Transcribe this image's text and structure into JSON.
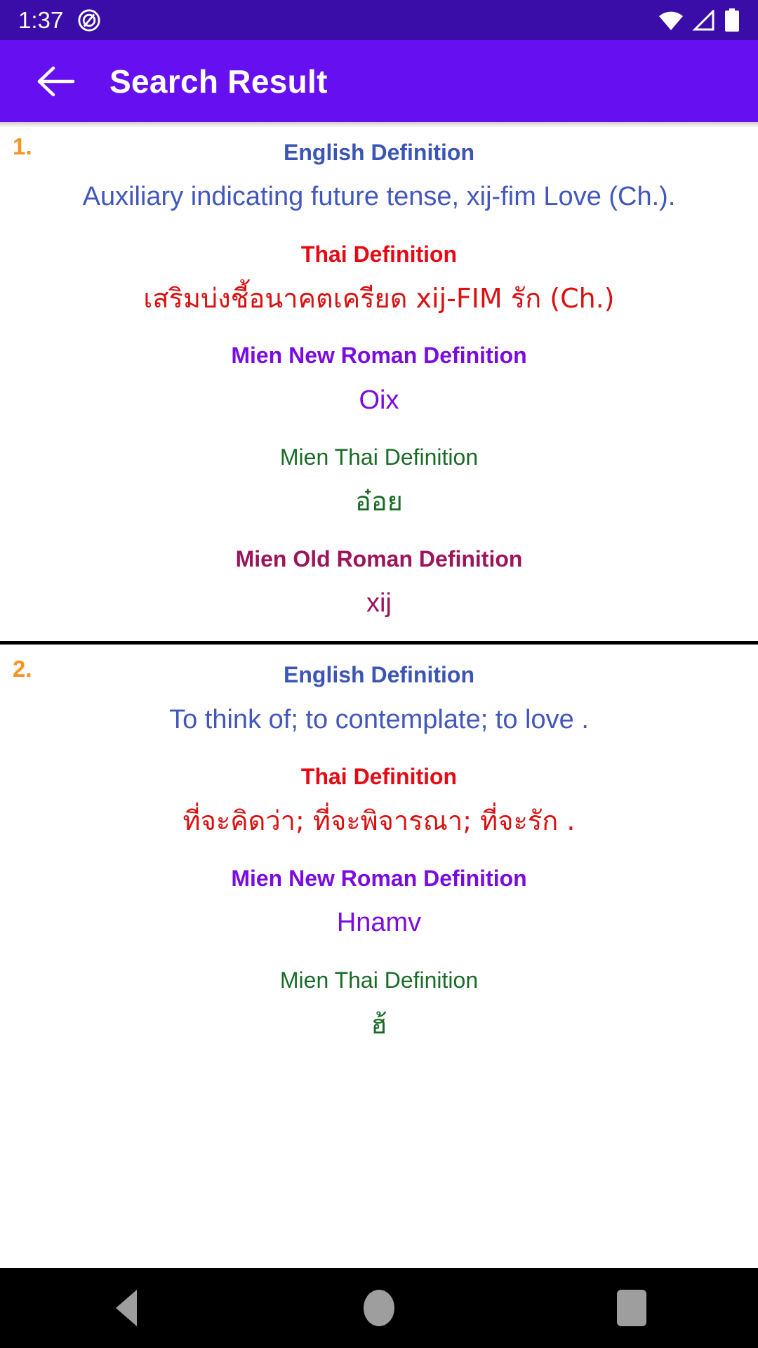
{
  "status_bar": {
    "time": "1:37",
    "app_icon": "app-notification-icon",
    "icons": [
      "wifi-icon",
      "cellular-signal-icon",
      "battery-icon"
    ],
    "background_color": "#3a0ca8"
  },
  "app_bar": {
    "back_icon": "arrow-left-icon",
    "title": "Search Result",
    "background_color": "#6610f2"
  },
  "colors": {
    "english_label": "#3b55b5",
    "english_value": "#4257bb",
    "thai_label": "#e50914",
    "thai_value": "#d81212",
    "mien_new_roman": "#7b0ce0",
    "mien_thai": "#1a6b28",
    "mien_old_roman": "#9c1459",
    "index_number": "#f79420",
    "divider": "#000000"
  },
  "results": [
    {
      "index": "1.",
      "fields": [
        {
          "label": "English Definition",
          "value": "Auxiliary indicating future tense, xij-fim Love (Ch.)."
        },
        {
          "label": "Thai Definition",
          "value": "เสริมบ่งชี้อนาคตเครียด xij-FIM รัก (Ch.)"
        },
        {
          "label": "Mien New Roman Definition",
          "value": "Oix"
        },
        {
          "label": "Mien Thai Definition",
          "value": "อ๋อย"
        },
        {
          "label": "Mien Old Roman Definition",
          "value": "xij"
        }
      ]
    },
    {
      "index": "2.",
      "fields": [
        {
          "label": "English Definition",
          "value": "To think of; to contemplate; to love ."
        },
        {
          "label": "Thai Definition",
          "value": "ที่จะคิดว่า; ที่จะพิจารณา; ที่จะรัก ."
        },
        {
          "label": "Mien New Roman Definition",
          "value": "Hnamv"
        },
        {
          "label": "Mien Thai Definition",
          "value": "ฮ้"
        }
      ]
    }
  ],
  "nav_bar": {
    "buttons": [
      {
        "icon": "nav-back-icon"
      },
      {
        "icon": "nav-home-icon"
      },
      {
        "icon": "nav-recents-icon"
      }
    ]
  }
}
